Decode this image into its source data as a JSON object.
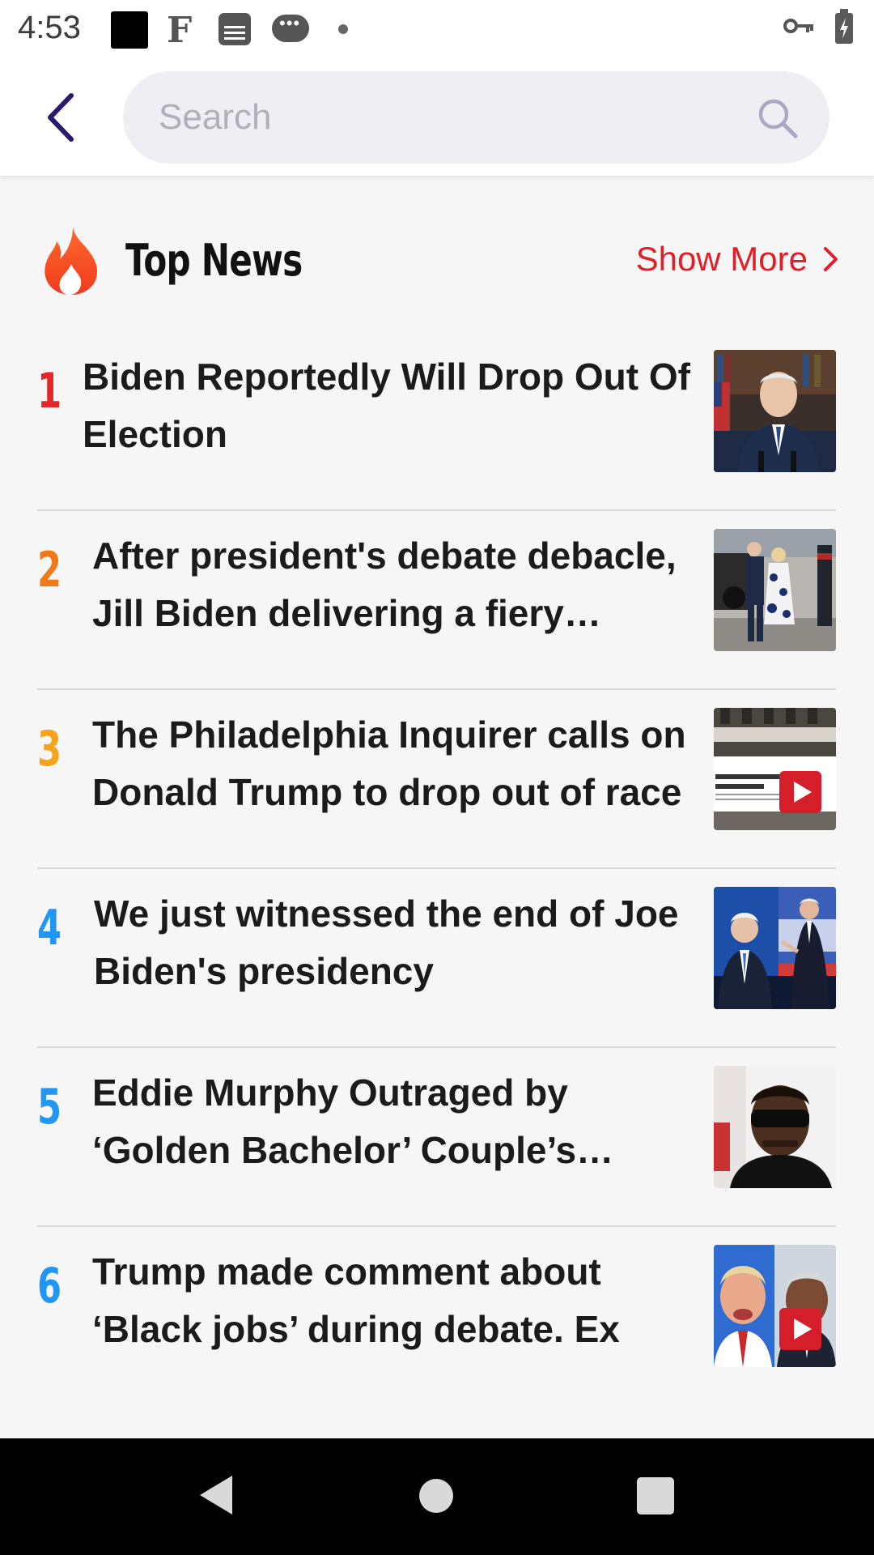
{
  "status_bar": {
    "time": "4:53",
    "icons": [
      "black-square-icon",
      "f-logo-icon",
      "local-news-icon",
      "chat-bubble-icon",
      "dot-icon",
      "vpn-key-icon",
      "battery-charging-icon"
    ]
  },
  "search": {
    "placeholder": "Search",
    "value": ""
  },
  "section": {
    "title": "Top News",
    "show_more": "Show More",
    "icon": "fire-icon"
  },
  "news": [
    {
      "rank": "1",
      "rank_color": "#e3262a",
      "title": "Biden Reportedly Will Drop Out Of Election",
      "has_video": false
    },
    {
      "rank": "2",
      "rank_color": "#f07a1a",
      "title": "After president's debate debacle, Jill Biden delivering a fiery defense of her husband",
      "has_video": false
    },
    {
      "rank": "3",
      "rank_color": "#f5a31a",
      "title": "The Philadelphia Inquirer calls on Donald Trump to drop out of race",
      "has_video": true
    },
    {
      "rank": "4",
      "rank_color": "#2196f3",
      "title": "We just witnessed the end of Joe Biden's presidency",
      "has_video": false
    },
    {
      "rank": "5",
      "rank_color": "#2196f3",
      "title": "Eddie Murphy Outraged by ‘Golden Bachelor’ Couple’s Breakup",
      "has_video": false
    },
    {
      "rank": "6",
      "rank_color": "#2196f3",
      "title": "Trump made comment about ‘Black jobs’ during debate. Ex",
      "has_video": true
    }
  ],
  "colors": {
    "accent": "#e31e26",
    "back_arrow": "#2b1a6b"
  }
}
